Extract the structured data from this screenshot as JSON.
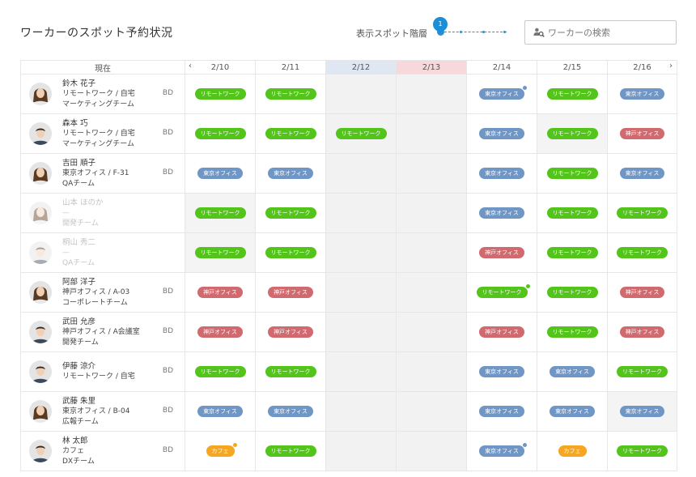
{
  "header": {
    "title": "ワーカーのスポット予約状況",
    "level_label": "表示スポット階層",
    "level_value": "1",
    "search_placeholder": "ワーカーの検索"
  },
  "table": {
    "current_label": "現在",
    "prev_icon": "chevron-left-icon",
    "next_icon": "chevron-right-icon",
    "prev_glyph": "‹",
    "next_glyph": "›",
    "dates": [
      "2/10",
      "2/11",
      "2/12",
      "2/13",
      "2/14",
      "2/15",
      "2/16"
    ],
    "today_index": 2,
    "holiday_index": 3
  },
  "labels": {
    "remote": "リモートワーク",
    "tokyo": "東京オフィス",
    "kobe": "神戸オフィス",
    "cafe": "カフェ"
  },
  "colors": {
    "remote": "#52c41a",
    "tokyo": "#6f96c4",
    "kobe": "#d16a6f",
    "cafe": "#f5a623",
    "accent": "#1a8ed8"
  },
  "workers": [
    {
      "name": "鈴木 花子",
      "location": "リモートワーク / 自宅",
      "team": "マーケティングチーム",
      "desk": "BD",
      "dim": false,
      "avatar": "female",
      "days": [
        {
          "s": "remote"
        },
        {
          "s": "remote"
        },
        {
          "s": ""
        },
        {
          "s": ""
        },
        {
          "s": "tokyo",
          "badge": "tokyo"
        },
        {
          "s": "remote"
        },
        {
          "s": "tokyo"
        }
      ]
    },
    {
      "name": "森本 巧",
      "location": "リモートワーク / 自宅",
      "team": "マーケティングチーム",
      "desk": "BD",
      "dim": false,
      "avatar": "male",
      "days": [
        {
          "s": "remote"
        },
        {
          "s": "remote"
        },
        {
          "s": "remote"
        },
        {
          "s": ""
        },
        {
          "s": "tokyo"
        },
        {
          "s": "remote",
          "blank": true
        },
        {
          "s": "kobe"
        }
      ]
    },
    {
      "name": "吉田 順子",
      "location": "東京オフィス / F-31",
      "team": "QAチーム",
      "desk": "BD",
      "dim": false,
      "avatar": "female",
      "days": [
        {
          "s": "tokyo"
        },
        {
          "s": "tokyo"
        },
        {
          "s": ""
        },
        {
          "s": ""
        },
        {
          "s": "tokyo"
        },
        {
          "s": "remote"
        },
        {
          "s": "tokyo"
        }
      ]
    },
    {
      "name": "山本 ほのか",
      "location": "—",
      "team": "開発チーム",
      "desk": "",
      "dim": true,
      "avatar": "female",
      "days": [
        {
          "s": "remote",
          "blank": true
        },
        {
          "s": "remote"
        },
        {
          "s": ""
        },
        {
          "s": ""
        },
        {
          "s": "tokyo"
        },
        {
          "s": "remote"
        },
        {
          "s": "remote"
        }
      ]
    },
    {
      "name": "桐山 秀二",
      "location": "—",
      "team": "QAチーム",
      "desk": "",
      "dim": true,
      "avatar": "male",
      "days": [
        {
          "s": "remote",
          "blank": true
        },
        {
          "s": "remote"
        },
        {
          "s": ""
        },
        {
          "s": ""
        },
        {
          "s": "kobe"
        },
        {
          "s": "remote"
        },
        {
          "s": "remote"
        }
      ]
    },
    {
      "name": "阿部 洋子",
      "location": "神戸オフィス / A-03",
      "team": "コーポレートチーム",
      "desk": "BD",
      "dim": false,
      "avatar": "female",
      "days": [
        {
          "s": "kobe"
        },
        {
          "s": "kobe"
        },
        {
          "s": ""
        },
        {
          "s": ""
        },
        {
          "s": "remote",
          "badge": "remote"
        },
        {
          "s": "remote"
        },
        {
          "s": "kobe"
        }
      ]
    },
    {
      "name": "武田 允彦",
      "location": "神戸オフィス / A会議室",
      "team": "開発チーム",
      "desk": "BD",
      "dim": false,
      "avatar": "male",
      "days": [
        {
          "s": "kobe"
        },
        {
          "s": "kobe"
        },
        {
          "s": ""
        },
        {
          "s": ""
        },
        {
          "s": "kobe"
        },
        {
          "s": "remote"
        },
        {
          "s": "kobe"
        }
      ]
    },
    {
      "name": "伊藤 涼介",
      "location": "リモートワーク / 自宅",
      "team": "",
      "desk": "BD",
      "dim": false,
      "avatar": "male",
      "days": [
        {
          "s": "remote"
        },
        {
          "s": "remote"
        },
        {
          "s": ""
        },
        {
          "s": ""
        },
        {
          "s": "tokyo"
        },
        {
          "s": "tokyo"
        },
        {
          "s": "remote"
        }
      ]
    },
    {
      "name": "武藤 朱里",
      "location": "東京オフィス / B-04",
      "team": "広報チーム",
      "desk": "BD",
      "dim": false,
      "avatar": "female",
      "days": [
        {
          "s": "tokyo"
        },
        {
          "s": "tokyo"
        },
        {
          "s": ""
        },
        {
          "s": ""
        },
        {
          "s": "tokyo"
        },
        {
          "s": "tokyo"
        },
        {
          "s": "tokyo",
          "blank": true
        }
      ]
    },
    {
      "name": "林 太郎",
      "location": "カフェ",
      "team": "DXチーム",
      "desk": "BD",
      "dim": false,
      "avatar": "male",
      "days": [
        {
          "s": "cafe",
          "badge": "cafe"
        },
        {
          "s": "remote"
        },
        {
          "s": ""
        },
        {
          "s": ""
        },
        {
          "s": "tokyo",
          "badge": "tokyo"
        },
        {
          "s": "cafe"
        },
        {
          "s": "remote"
        }
      ]
    }
  ]
}
